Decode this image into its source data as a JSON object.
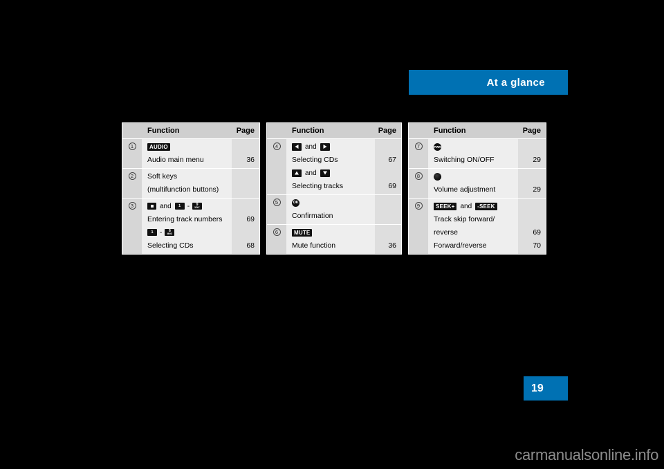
{
  "header": {
    "title": "At a glance"
  },
  "page_number": "19",
  "watermark": "carmanualsonline.info",
  "columns": {
    "function": "Function",
    "page": "Page"
  },
  "tables": [
    {
      "id": "table-1",
      "rows": [
        {
          "marker": "1",
          "keys": [
            {
              "type": "label",
              "text": "AUDIO"
            }
          ],
          "lines": [
            {
              "text": "Audio main menu",
              "page": "36"
            }
          ]
        },
        {
          "marker": "2",
          "keys": [],
          "lines": [
            {
              "text": "Soft keys",
              "page": ""
            },
            {
              "text": "(multifunction buttons)",
              "page": ""
            }
          ]
        },
        {
          "marker": "3",
          "keys": [
            {
              "type": "star",
              "text": "*"
            },
            {
              "type": "and",
              "text": "and"
            },
            {
              "type": "digit",
              "text": "1",
              "sub": ""
            },
            {
              "type": "dash",
              "text": "-"
            },
            {
              "type": "digit",
              "text": "9",
              "sub": "WXY"
            }
          ],
          "lines": [
            {
              "text": "Entering track numbers",
              "page": "69"
            }
          ],
          "keys2": [
            {
              "type": "digit",
              "text": "1",
              "sub": ""
            },
            {
              "type": "dash",
              "text": "-"
            },
            {
              "type": "digit",
              "text": "6",
              "sub": "MNO"
            }
          ],
          "lines2": [
            {
              "text": "Selecting CDs",
              "page": "68"
            }
          ]
        }
      ]
    },
    {
      "id": "table-2",
      "rows": [
        {
          "marker": "4",
          "keys": [
            {
              "type": "arrow-left",
              "text": ""
            },
            {
              "type": "and",
              "text": "and"
            },
            {
              "type": "arrow-right",
              "text": ""
            }
          ],
          "lines": [
            {
              "text": "Selecting CDs",
              "page": "67"
            }
          ],
          "keys2": [
            {
              "type": "arrow-up",
              "text": ""
            },
            {
              "type": "and",
              "text": "and"
            },
            {
              "type": "arrow-down",
              "text": ""
            }
          ],
          "lines2": [
            {
              "text": "Selecting tracks",
              "page": "69"
            }
          ]
        },
        {
          "marker": "5",
          "keys": [
            {
              "type": "knob-ok",
              "text": "OK"
            }
          ],
          "lines": [
            {
              "text": "Confirmation",
              "page": ""
            }
          ]
        },
        {
          "marker": "6",
          "keys": [
            {
              "type": "label",
              "text": "MUTE"
            }
          ],
          "lines": [
            {
              "text": "Mute function",
              "page": "36"
            }
          ]
        }
      ]
    },
    {
      "id": "table-3",
      "rows": [
        {
          "marker": "7",
          "keys": [
            {
              "type": "knob-pwr",
              "text": "PWR"
            }
          ],
          "lines": [
            {
              "text": "Switching ON/OFF",
              "page": "29"
            }
          ]
        },
        {
          "marker": "8",
          "keys": [
            {
              "type": "knob-plain",
              "text": ""
            }
          ],
          "lines": [
            {
              "text": "Volume adjustment",
              "page": "29"
            }
          ]
        },
        {
          "marker": "9",
          "keys": [
            {
              "type": "label",
              "text": "SEEK+"
            },
            {
              "type": "and",
              "text": "and"
            },
            {
              "type": "label",
              "text": "-SEEK"
            }
          ],
          "lines": [
            {
              "text": "Track skip forward/",
              "page": ""
            },
            {
              "text": "reverse",
              "page": "69"
            },
            {
              "text": "Forward/reverse",
              "page": "70"
            }
          ]
        }
      ]
    }
  ],
  "colors": {
    "accent": "#0071b3",
    "key_black": "#111111",
    "table_bg": "#eeeeee"
  }
}
